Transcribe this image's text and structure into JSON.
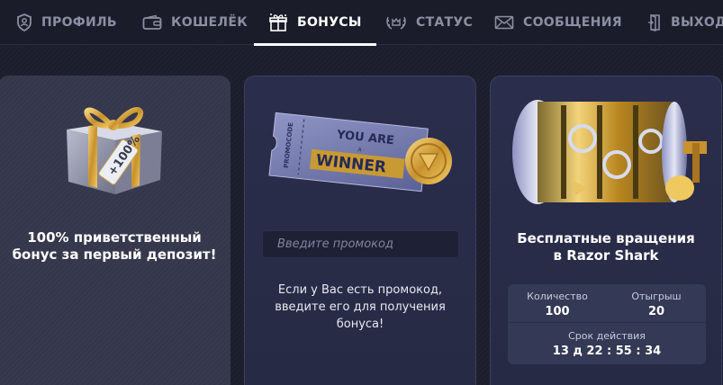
{
  "nav": {
    "items": [
      {
        "label": "ПРОФИЛЬ",
        "icon": "shield-user-icon",
        "active": false
      },
      {
        "label": "КОШЕЛЁК",
        "icon": "wallet-icon",
        "active": false
      },
      {
        "label": "БОНУСЫ",
        "icon": "gift-icon",
        "active": true
      },
      {
        "label": "СТАТУС",
        "icon": "laurel-crown-icon",
        "active": false
      },
      {
        "label": "СООБЩЕНИЯ",
        "icon": "envelope-icon",
        "active": false
      },
      {
        "label": "ВЫХОД",
        "icon": "logout-door-icon",
        "active": false
      }
    ]
  },
  "cards": {
    "welcome": {
      "title_line1": "100% приветственный",
      "title_line2": "бонус за первый депозит!",
      "tag_text": "+100%"
    },
    "promo": {
      "ticket_top": "YOU ARE",
      "ticket_mid": "A",
      "ticket_main": "WINNER",
      "ticket_side": "PROMOCODE",
      "input_placeholder": "Введите промокод",
      "text_line1": "Если у Вас есть промокод,",
      "text_line2": "введите его для получения",
      "text_line3": "бонуса!"
    },
    "freespins": {
      "title_line1": "Бесплатные вращения",
      "title_line2": "в Razor Shark",
      "count_label": "Количество",
      "count_value": "100",
      "win_label": "Отыгрыш",
      "win_value": "20",
      "expiry_label": "Срок действия",
      "expiry_value": "13 д 22 : 55 : 34"
    }
  },
  "colors": {
    "background": "#1b1d2a",
    "nav_bg": "#1a1c29",
    "nav_inactive": "#8c8fa3",
    "card_bg": "#2a2e4c",
    "gold": "#d9a93a"
  }
}
